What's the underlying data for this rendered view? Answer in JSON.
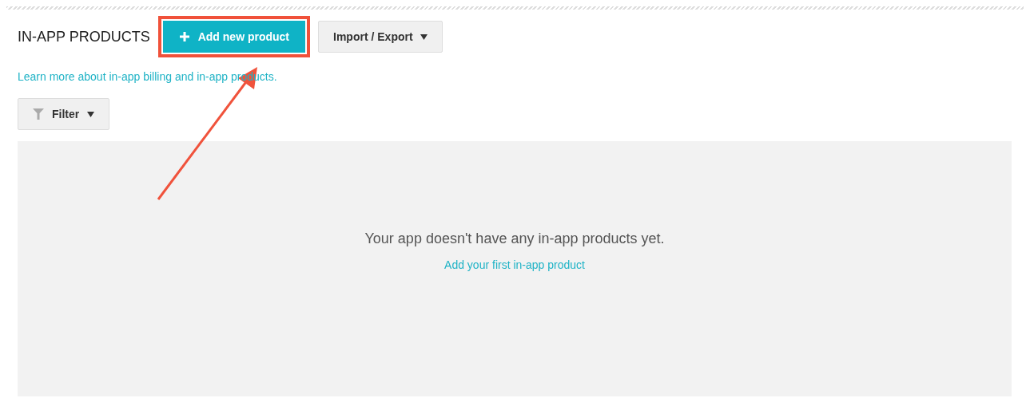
{
  "header": {
    "title": "IN-APP PRODUCTS",
    "add_button": "Add new product",
    "import_export_button": "Import / Export"
  },
  "learn_more_link": "Learn more about in-app billing and in-app products.",
  "filter_button": "Filter",
  "empty_state": {
    "message": "Your app doesn't have any in-app products yet.",
    "link": "Add your first in-app product"
  }
}
